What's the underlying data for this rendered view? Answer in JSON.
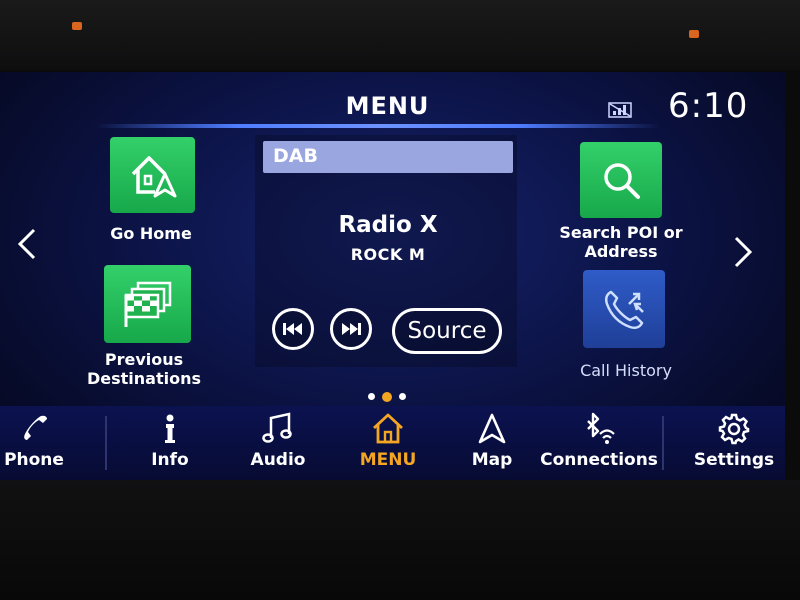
{
  "status": {
    "title": "MENU",
    "time": "6:10"
  },
  "shortcuts": {
    "go_home": {
      "label": "Go Home"
    },
    "previous_destinations": {
      "label_line1": "Previous",
      "label_line2": "Destinations"
    },
    "search_poi": {
      "label_line1": "Search POI or",
      "label_line2": "Address"
    },
    "call_history": {
      "label": "Call History"
    }
  },
  "radio": {
    "band": "DAB",
    "station": "Radio X",
    "programme": "ROCK M",
    "source_label": "Source"
  },
  "pagination": {
    "count": 3,
    "active": 2
  },
  "bottom_nav": {
    "phone": "Phone",
    "info": "Info",
    "audio": "Audio",
    "menu": "MENU",
    "map": "Map",
    "connections": "Connections",
    "settings": "Settings"
  },
  "colors": {
    "accent_active": "#f4a623",
    "tile_green": "#22b955",
    "tile_blue": "#2a4fb5",
    "screen_bg": "#0c1448"
  }
}
